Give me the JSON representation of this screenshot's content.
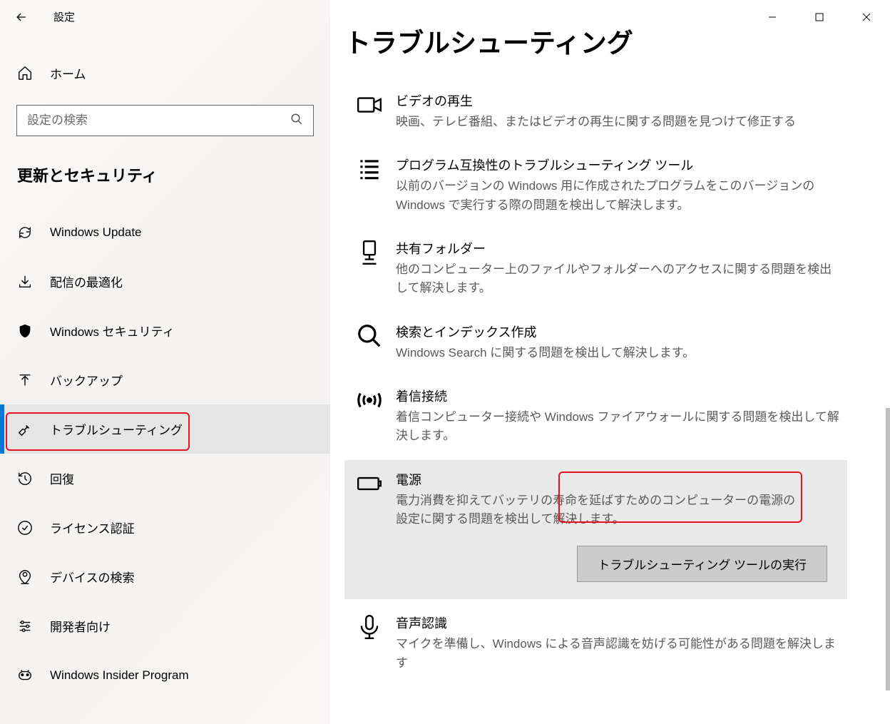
{
  "window": {
    "title": "設定"
  },
  "sidebar": {
    "home": "ホーム",
    "search_placeholder": "設定の検索",
    "section": "更新とセキュリティ",
    "items": [
      {
        "label": "Windows Update"
      },
      {
        "label": "配信の最適化"
      },
      {
        "label": "Windows セキュリティ"
      },
      {
        "label": "バックアップ"
      },
      {
        "label": "トラブルシューティング",
        "selected": true
      },
      {
        "label": "回復"
      },
      {
        "label": "ライセンス認証"
      },
      {
        "label": "デバイスの検索"
      },
      {
        "label": "開発者向け"
      },
      {
        "label": "Windows Insider Program"
      }
    ]
  },
  "main": {
    "title": "トラブルシューティング",
    "items": [
      {
        "title": "ビデオの再生",
        "desc": "映画、テレビ番組、またはビデオの再生に関する問題を見つけて修正する"
      },
      {
        "title": "プログラム互換性のトラブルシューティング ツール",
        "desc": "以前のバージョンの Windows 用に作成されたプログラムをこのバージョンの Windows で実行する際の問題を検出して解決します。"
      },
      {
        "title": "共有フォルダー",
        "desc": "他のコンピューター上のファイルやフォルダーへのアクセスに関する問題を検出して解決します。"
      },
      {
        "title": "検索とインデックス作成",
        "desc": "Windows Search に関する問題を検出して解決します。"
      },
      {
        "title": "着信接続",
        "desc": "着信コンピューター接続や Windows ファイアウォールに関する問題を検出して解決します。"
      },
      {
        "title": "電源",
        "desc": "電力消費を抑えてバッテリの寿命を延ばすためのコンピューターの電源の設定に関する問題を検出して解決します。",
        "expanded": true
      },
      {
        "title": "音声認識",
        "desc": "マイクを準備し、Windows による音声認識を妨げる可能性がある問題を解決します"
      }
    ],
    "run_button": "トラブルシューティング ツールの実行"
  }
}
